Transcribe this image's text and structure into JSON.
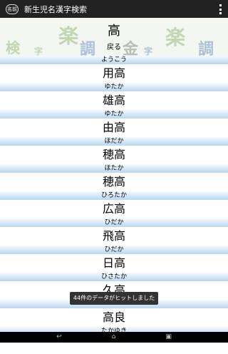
{
  "app": {
    "title": "新生児名漢字検索",
    "icon_label": "名前"
  },
  "banner": {
    "search_kanji": "高",
    "back_label": "戻る",
    "deco_chars": [
      "検",
      "字",
      "楽",
      "調",
      "金",
      "字",
      "楽",
      "調"
    ]
  },
  "results": [
    {
      "reading": "ようこう",
      "name": "用高"
    },
    {
      "reading": "ゆたか",
      "name": "雄高"
    },
    {
      "reading": "ゆたか",
      "name": "由高"
    },
    {
      "reading": "ほだか",
      "name": "穂高"
    },
    {
      "reading": "ほたか",
      "name": "穂高"
    },
    {
      "reading": "ひろたか",
      "name": "広高"
    },
    {
      "reading": "ひだか",
      "name": "飛高"
    },
    {
      "reading": "ひだか",
      "name": "日高"
    },
    {
      "reading": "ひさたか",
      "name": "久高"
    },
    {
      "reading": "",
      "name": "高良"
    },
    {
      "reading": "たかゆき",
      "name": ""
    }
  ],
  "toast": "44件のデータがヒットしました",
  "icons": {
    "overflow": "overflow-menu-icon",
    "back": "back-icon",
    "home": "home-icon",
    "recents": "recents-icon"
  }
}
